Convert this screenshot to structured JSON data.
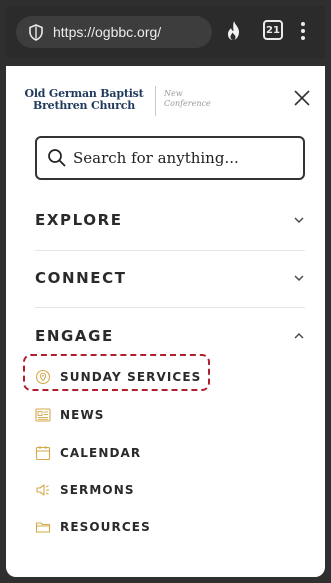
{
  "browser": {
    "url": "https://ogbbc.org/",
    "tab_count": "21"
  },
  "site": {
    "logo_main_line1": "Old German Baptist",
    "logo_main_line2": "Brethren Church",
    "logo_sub_line1": "New",
    "logo_sub_line2": "Conference"
  },
  "search": {
    "placeholder": "Search for anything..."
  },
  "nav": {
    "sections": [
      {
        "label": "EXPLORE",
        "expanded": false
      },
      {
        "label": "CONNECT",
        "expanded": false
      },
      {
        "label": "ENGAGE",
        "expanded": true
      }
    ],
    "engage_items": [
      {
        "label": "SUNDAY SERVICES",
        "icon": "location-pin-icon",
        "highlighted": true
      },
      {
        "label": "NEWS",
        "icon": "newspaper-icon"
      },
      {
        "label": "CALENDAR",
        "icon": "calendar-icon"
      },
      {
        "label": "SERMONS",
        "icon": "speaker-icon"
      },
      {
        "label": "RESOURCES",
        "icon": "folder-icon"
      }
    ]
  },
  "colors": {
    "logo_navy": "#1f3a5c",
    "highlight_red": "#b01f2e",
    "icon_gold": "#d4a84a"
  }
}
